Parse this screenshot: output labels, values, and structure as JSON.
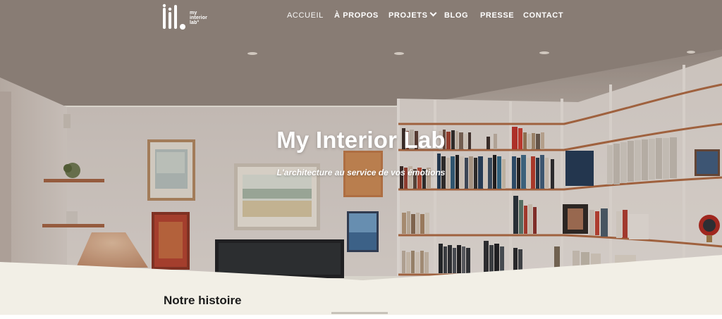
{
  "header": {
    "logo_text_lines": [
      "my",
      "interior",
      "lab°"
    ],
    "nav": [
      {
        "label": "ACCUEIL",
        "active": true
      },
      {
        "label": "À PROPOS"
      },
      {
        "label": "PROJETS",
        "has_dropdown": true
      },
      {
        "label": "BLOG"
      },
      {
        "label": "PRESSE"
      },
      {
        "label": "CONTACT"
      }
    ]
  },
  "hero": {
    "title": "My Interior Lab",
    "subtitle": "L'architecture au service de vos émotions"
  },
  "section": {
    "title": "Notre histoire"
  },
  "colors": {
    "cream": "#f2efe6",
    "wall": "#d9d2cb",
    "wood": "#b06a43",
    "text_dark": "#1b1b1b"
  }
}
